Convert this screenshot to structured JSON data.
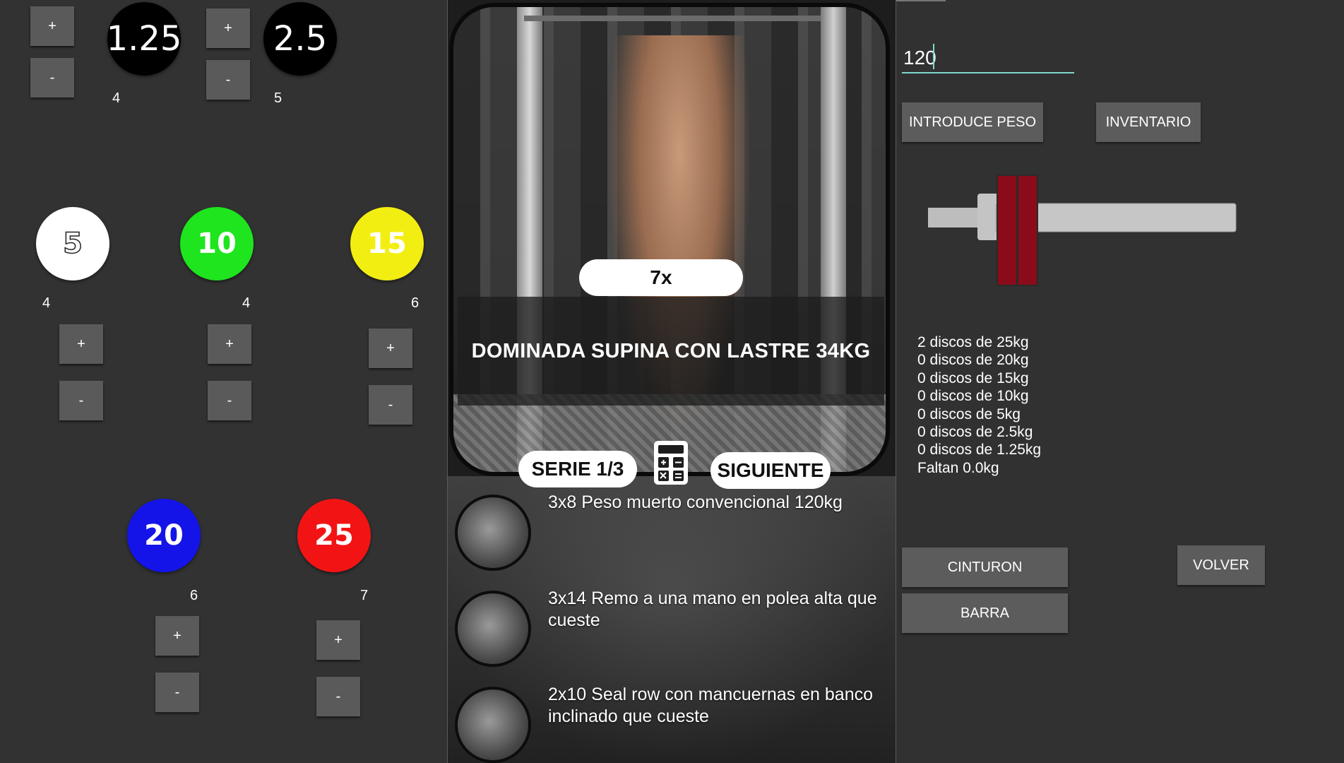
{
  "plates_panel": {
    "small_plates": [
      {
        "label": "1.25",
        "count": "4",
        "color": "#000000"
      },
      {
        "label": "2.5",
        "count": "5",
        "color": "#000000"
      }
    ],
    "plates": [
      {
        "label": "5",
        "count": "4",
        "color": "#ffffff"
      },
      {
        "label": "10",
        "count": "4",
        "color": "#1ee51e"
      },
      {
        "label": "15",
        "count": "6",
        "color": "#f3ee12"
      },
      {
        "label": "20",
        "count": "6",
        "color": "#1414e8"
      },
      {
        "label": "25",
        "count": "7",
        "color": "#f21414"
      }
    ],
    "plus_label": "+",
    "minus_label": "-"
  },
  "workout": {
    "reps": "7x",
    "exercise_title": "DOMINADA SUPINA CON LASTRE 34KG",
    "serie_label": "SERIE 1/3",
    "next_label": "SIGUIENTE",
    "calculator_icon": "calculator-icon",
    "upcoming": [
      {
        "text": "3x8 Peso muerto convencional 120kg"
      },
      {
        "text": "3x14 Remo a una mano en polea alta que cueste"
      },
      {
        "text": "2x10 Seal row con mancuernas en banco inclinado que cueste"
      }
    ]
  },
  "calculator": {
    "weight_value": "120",
    "enter_weight_label": "INTRODUCE PESO",
    "inventory_label": "INVENTARIO",
    "plate_color": "#8a0c1a",
    "results": [
      "2 discos de 25kg",
      "0 discos de 20kg",
      "0 discos de 15kg",
      "0 discos de 10kg",
      "0 discos de 5kg",
      "0 discos de 2.5kg",
      "0 discos de 1.25kg",
      "Faltan 0.0kg"
    ],
    "belt_label": "CINTURON",
    "bar_label": "BARRA",
    "back_label": "VOLVER"
  }
}
